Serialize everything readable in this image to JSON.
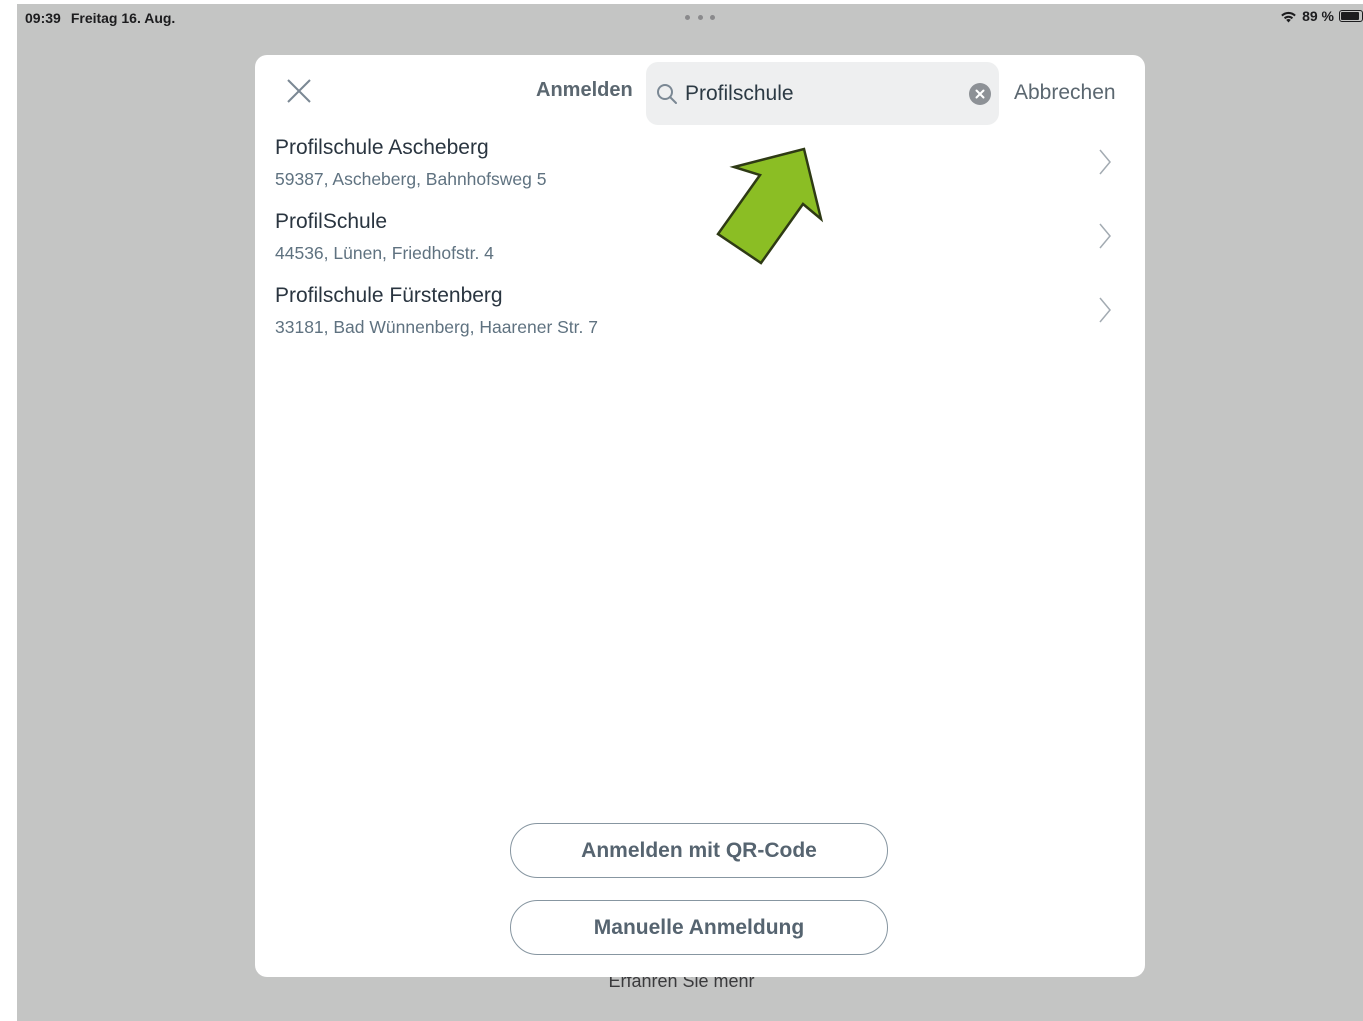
{
  "status_bar": {
    "time": "09:39",
    "date": "Freitag 16. Aug.",
    "battery": "89 %",
    "battery_level": 0.89
  },
  "background": {
    "link_text": "Erfahren Sie mehr"
  },
  "modal": {
    "title": "Anmelden",
    "search": {
      "value": "Profilschule"
    },
    "cancel_label": "Abbrechen",
    "results": [
      {
        "name": "Profilschule Ascheberg",
        "address": "59387, Ascheberg, Bahnhofsweg 5"
      },
      {
        "name": "ProfilSchule",
        "address": "44536, Lünen, Friedhofstr. 4"
      },
      {
        "name": "Profilschule Fürstenberg",
        "address": "33181, Bad Wünnenberg, Haarener Str. 7"
      }
    ],
    "qr_button_label": "Anmelden mit QR-Code",
    "manual_button_label": "Manuelle Anmeldung"
  },
  "annotation": {
    "arrow_color": "#8bbe24"
  }
}
